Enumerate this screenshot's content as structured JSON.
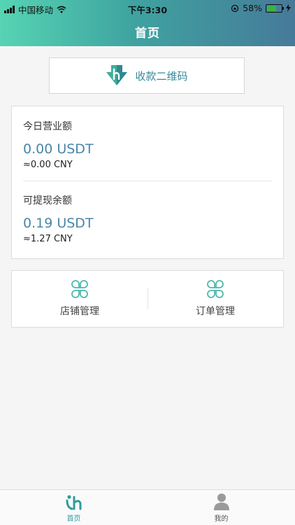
{
  "status_bar": {
    "carrier": "中国移动",
    "time": "下午3:30",
    "battery_percent": "58%",
    "battery_level": 0.58
  },
  "header": {
    "title": "首页"
  },
  "qr_button": {
    "label": "收款二维码"
  },
  "today_revenue": {
    "label": "今日营业额",
    "value": "0.00 USDT",
    "cny": "≈0.00 CNY"
  },
  "withdrawable": {
    "label": "可提现余额",
    "value": "0.19 USDT",
    "cny": "≈1.27 CNY"
  },
  "tiles": [
    {
      "label": "店铺管理",
      "icon": "clover-icon"
    },
    {
      "label": "订单管理",
      "icon": "clover-icon"
    }
  ],
  "tabbar": {
    "items": [
      {
        "label": "首页",
        "icon": "home-logo-icon",
        "active": true
      },
      {
        "label": "我的",
        "icon": "user-icon",
        "active": false
      }
    ]
  },
  "colors": {
    "header_gradient": [
      "#56d4b3",
      "#3fa3a0",
      "#467a99"
    ],
    "accent": "#35889a",
    "value_blue": "#4a86a8"
  }
}
